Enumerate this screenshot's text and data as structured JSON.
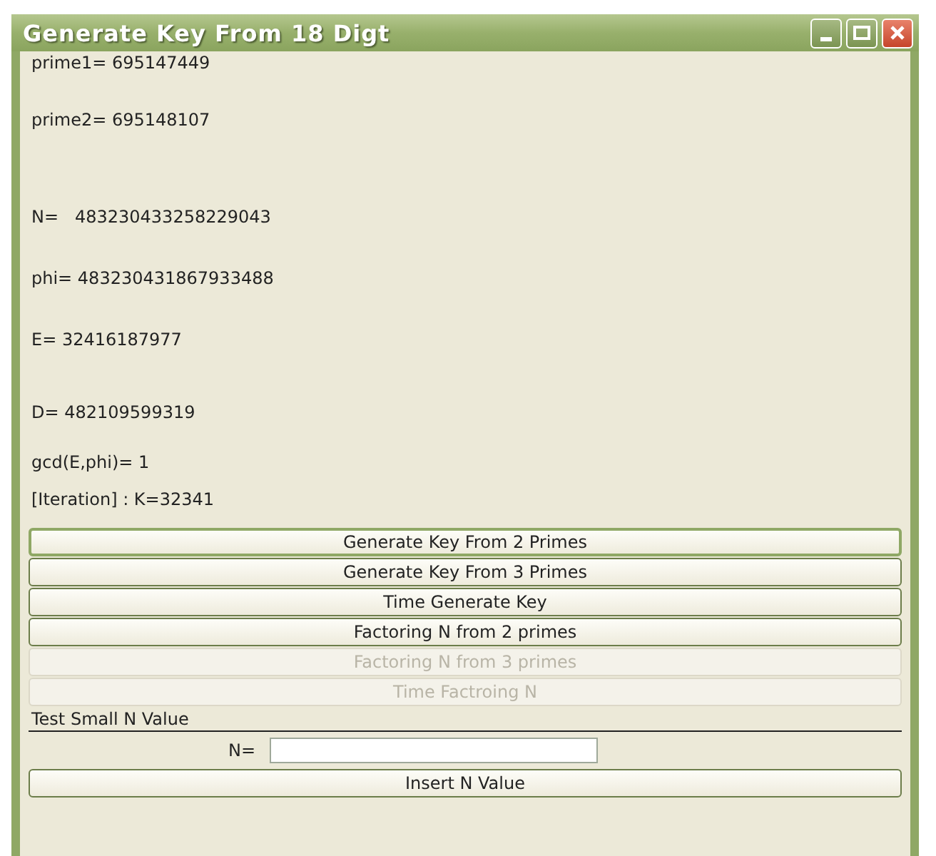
{
  "window": {
    "title": "Generate Key From 18 Digt",
    "controls": [
      {
        "kind": "minimize"
      },
      {
        "kind": "maximize"
      },
      {
        "kind": "close"
      }
    ]
  },
  "results": [
    "prime1= 695147449",
    "prime2= 695148107",
    "N=   483230433258229043",
    "phi= 483230431867933488",
    "E= 32416187977",
    "D= 482109599319",
    "gcd(E,phi)= 1",
    "[Iteration] : K=32341"
  ],
  "buttons": [
    {
      "label": "Generate Key From 2 Primes",
      "disabled": false,
      "focused": true
    },
    {
      "label": "Generate Key From 3 Primes",
      "disabled": false,
      "focused": false
    },
    {
      "label": "Time Generate Key",
      "disabled": false,
      "focused": false
    },
    {
      "label": "Factoring N from 2 primes",
      "disabled": false,
      "focused": false
    },
    {
      "label": "Factoring N from 3 primes",
      "disabled": true,
      "focused": false
    },
    {
      "label": "Time Factroing N",
      "disabled": true,
      "focused": false
    }
  ],
  "test_section": {
    "heading": "Test Small N Value",
    "field_label": "N=",
    "button": "Insert N Value"
  }
}
